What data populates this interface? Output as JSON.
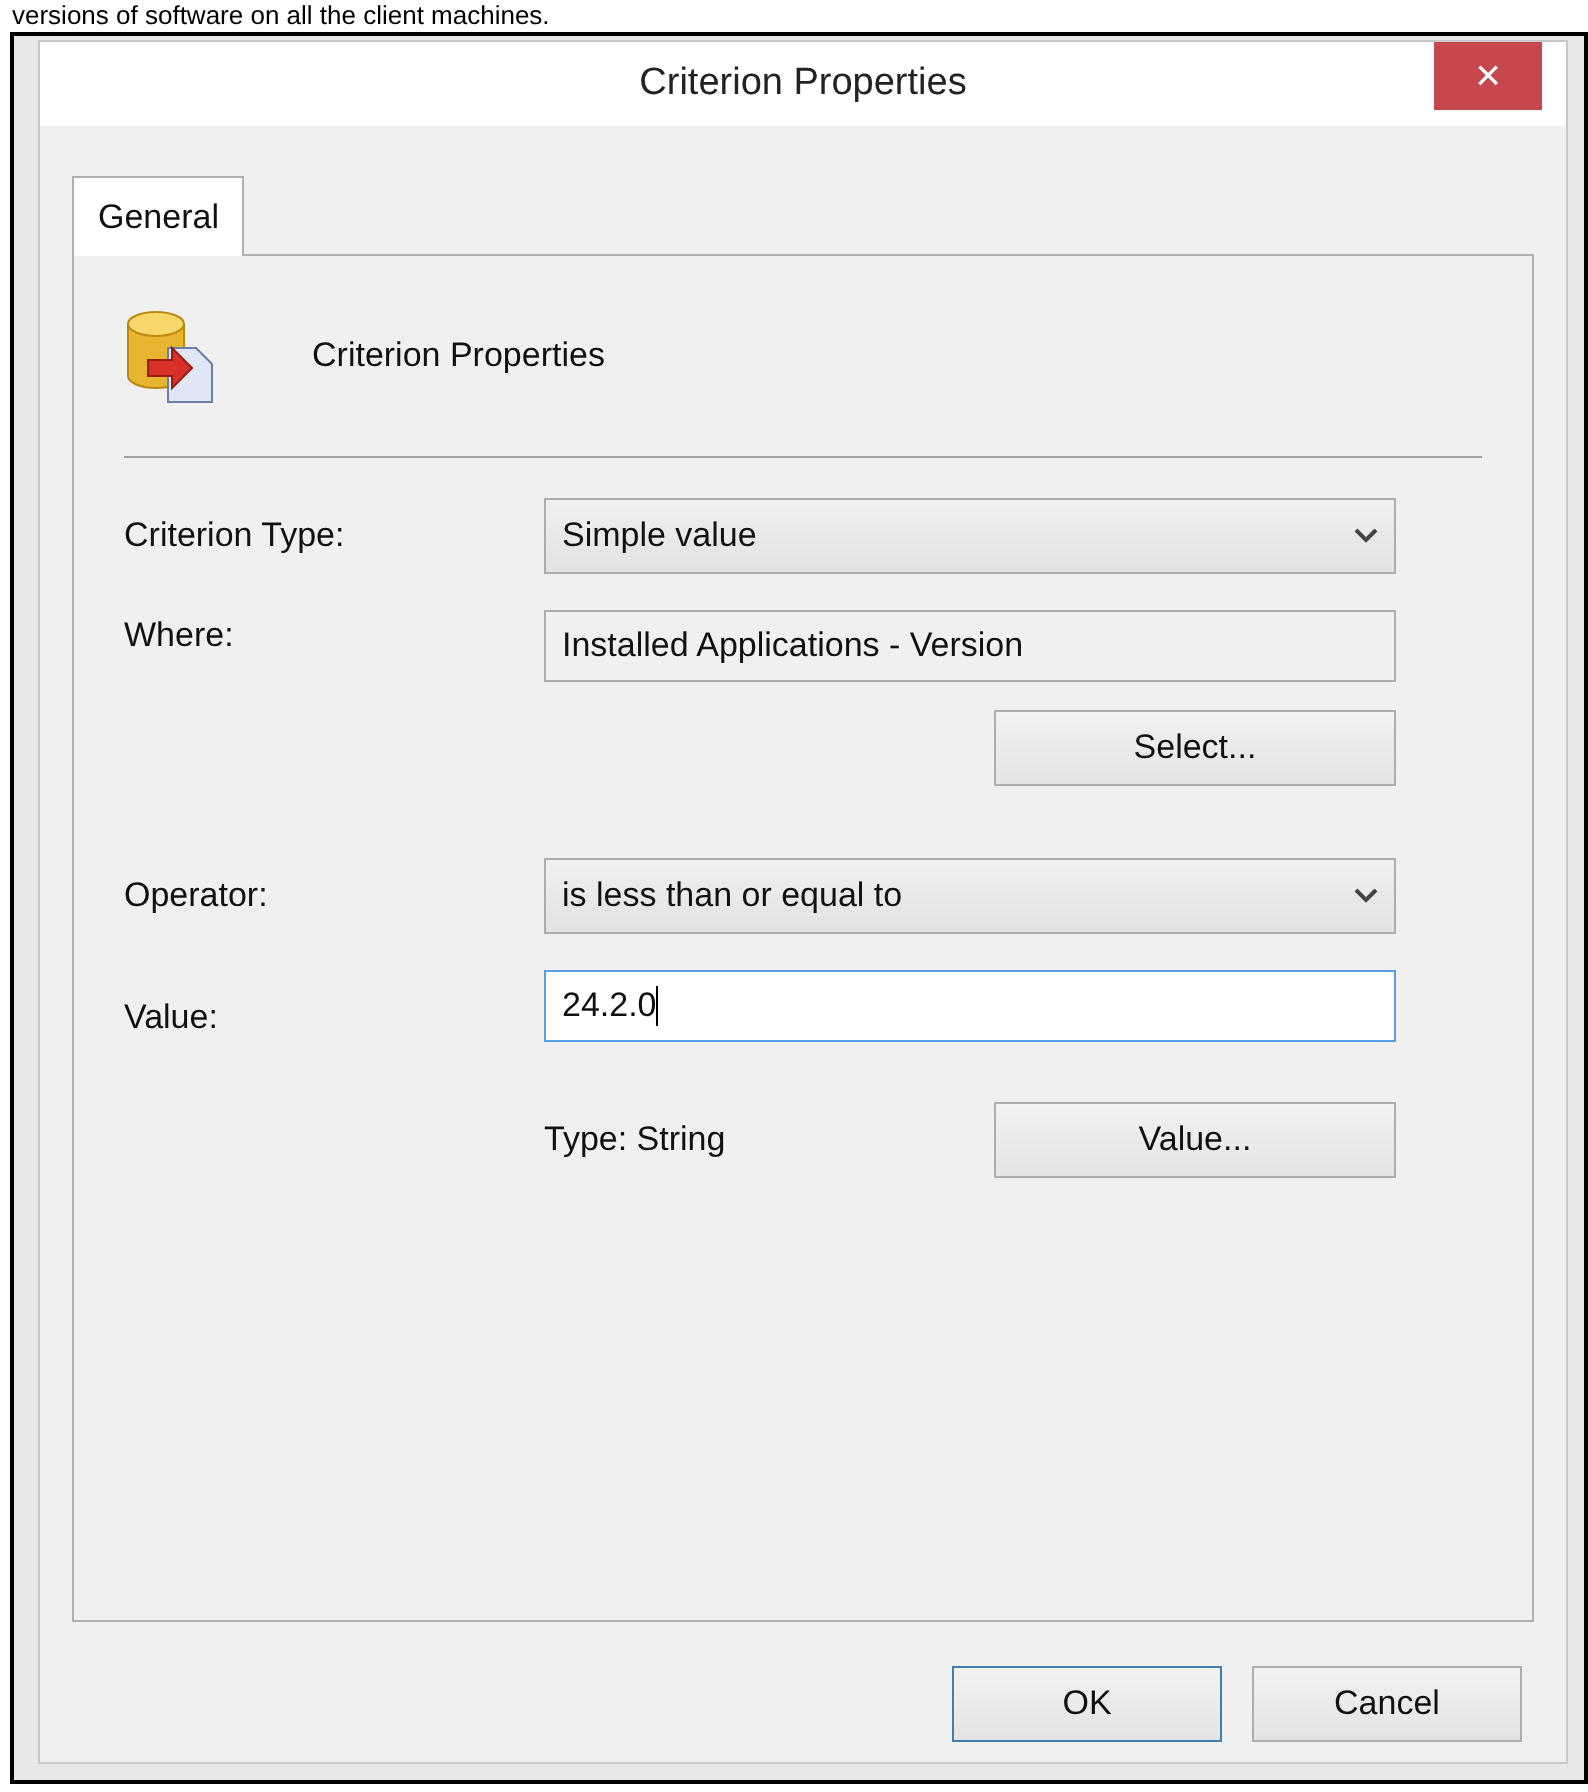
{
  "page_text": "versions of software on all the client machines.",
  "window": {
    "title": "Criterion Properties",
    "close": "×"
  },
  "tabs": [
    {
      "label": "General",
      "selected": true
    }
  ],
  "header": {
    "title": "Criterion Properties"
  },
  "fields": [
    {
      "kind": "dropdown",
      "label": "Criterion Type:",
      "value": "Simple value"
    },
    {
      "kind": "readonly",
      "label": "Where:",
      "value": "Installed Applications - Version"
    },
    {
      "kind": "button",
      "button": "Select..."
    },
    {
      "kind": "dropdown",
      "label": "Operator:",
      "value": "is less than or equal to"
    },
    {
      "kind": "input",
      "label": "Value:",
      "value": "24.2.0",
      "focused": true
    },
    {
      "kind": "info",
      "text": "Type: String",
      "button": "Value..."
    }
  ],
  "buttons": [
    {
      "label": "OK",
      "default": true
    },
    {
      "label": "Cancel",
      "default": false
    }
  ]
}
